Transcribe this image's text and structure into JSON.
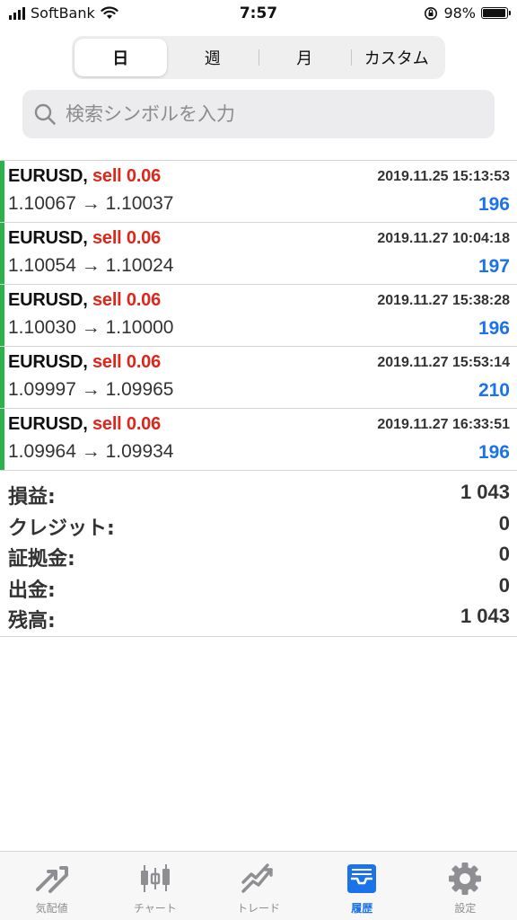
{
  "status_bar": {
    "carrier": "SoftBank",
    "time": "7:57",
    "battery": "98%",
    "battery_level": 0.98
  },
  "period_tabs": [
    {
      "label": "日",
      "active": true
    },
    {
      "label": "週",
      "active": false
    },
    {
      "label": "月",
      "active": false
    },
    {
      "label": "カスタム",
      "active": false
    }
  ],
  "search": {
    "placeholder": "検索シンボルを入力"
  },
  "trades": [
    {
      "symbol": "EURUSD,",
      "side": "sell 0.06",
      "time": "2019.11.25 15:13:53",
      "prices": "1.10067 → 1.10037",
      "profit": "196"
    },
    {
      "symbol": "EURUSD,",
      "side": "sell 0.06",
      "time": "2019.11.27 10:04:18",
      "prices": "1.10054 → 1.10024",
      "profit": "197"
    },
    {
      "symbol": "EURUSD,",
      "side": "sell 0.06",
      "time": "2019.11.27 15:38:28",
      "prices": "1.10030 → 1.10000",
      "profit": "196"
    },
    {
      "symbol": "EURUSD,",
      "side": "sell 0.06",
      "time": "2019.11.27 15:53:14",
      "prices": "1.09997 → 1.09965",
      "profit": "210"
    },
    {
      "symbol": "EURUSD,",
      "side": "sell 0.06",
      "time": "2019.11.27 16:33:51",
      "prices": "1.09964 → 1.09934",
      "profit": "196"
    }
  ],
  "summary": [
    {
      "label": "損益:",
      "value": "1 043"
    },
    {
      "label": "クレジット:",
      "value": "0"
    },
    {
      "label": "証拠金:",
      "value": "0"
    },
    {
      "label": "出金:",
      "value": "0"
    },
    {
      "label": "残高:",
      "value": "1 043"
    }
  ],
  "tab_bar": [
    {
      "label": "気配値",
      "icon": "quotes-icon",
      "active": false
    },
    {
      "label": "チャート",
      "icon": "chart-icon",
      "active": false
    },
    {
      "label": "トレード",
      "icon": "trade-icon",
      "active": false
    },
    {
      "label": "履歴",
      "icon": "history-icon",
      "active": true
    },
    {
      "label": "設定",
      "icon": "settings-icon",
      "active": false
    }
  ],
  "colors": {
    "buy_bar": "#2cb24a",
    "sell_text": "#e0251b",
    "profit_text": "#1a73e8",
    "active_tab": "#1a73e8",
    "inactive_tab": "#8e8e93"
  }
}
